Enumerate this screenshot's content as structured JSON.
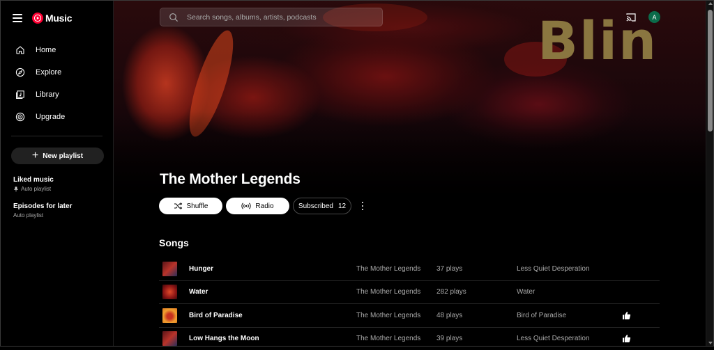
{
  "app": {
    "logo_text": "Music",
    "brand_color": "#ff0033"
  },
  "sidebar": {
    "items": [
      {
        "label": "Home",
        "icon": "home-icon"
      },
      {
        "label": "Explore",
        "icon": "compass-icon"
      },
      {
        "label": "Library",
        "icon": "library-icon"
      },
      {
        "label": "Upgrade",
        "icon": "upgrade-icon"
      }
    ],
    "new_playlist_label": "New playlist",
    "library": [
      {
        "title": "Liked music",
        "subtitle": "Auto playlist",
        "pinned": true
      },
      {
        "title": "Episodes for later",
        "subtitle": "Auto playlist",
        "pinned": false
      }
    ]
  },
  "search": {
    "placeholder": "Search songs, albums, artists, podcasts"
  },
  "header": {
    "avatar_initial": "A",
    "avatar_color": "#0b6b4a"
  },
  "hero": {
    "banner_text": "Blin"
  },
  "artist": {
    "name": "The Mother Legends",
    "shuffle_label": "Shuffle",
    "radio_label": "Radio",
    "subscribed_label": "Subscribed",
    "subscriber_count": "12"
  },
  "songs": {
    "title": "Songs",
    "rows": [
      {
        "title": "Hunger",
        "artist": "The Mother Legends",
        "plays": "37 plays",
        "album": "Less Quiet Desperation",
        "liked": false,
        "thumb": "blue"
      },
      {
        "title": "Water",
        "artist": "The Mother Legends",
        "plays": "282 plays",
        "album": "Water",
        "liked": false,
        "thumb": "red"
      },
      {
        "title": "Bird of Paradise",
        "artist": "The Mother Legends",
        "plays": "48 plays",
        "album": "Bird of Paradise",
        "liked": true,
        "thumb": "orange"
      },
      {
        "title": "Low Hangs the Moon",
        "artist": "The Mother Legends",
        "plays": "39 plays",
        "album": "Less Quiet Desperation",
        "liked": true,
        "thumb": "blue"
      }
    ]
  }
}
